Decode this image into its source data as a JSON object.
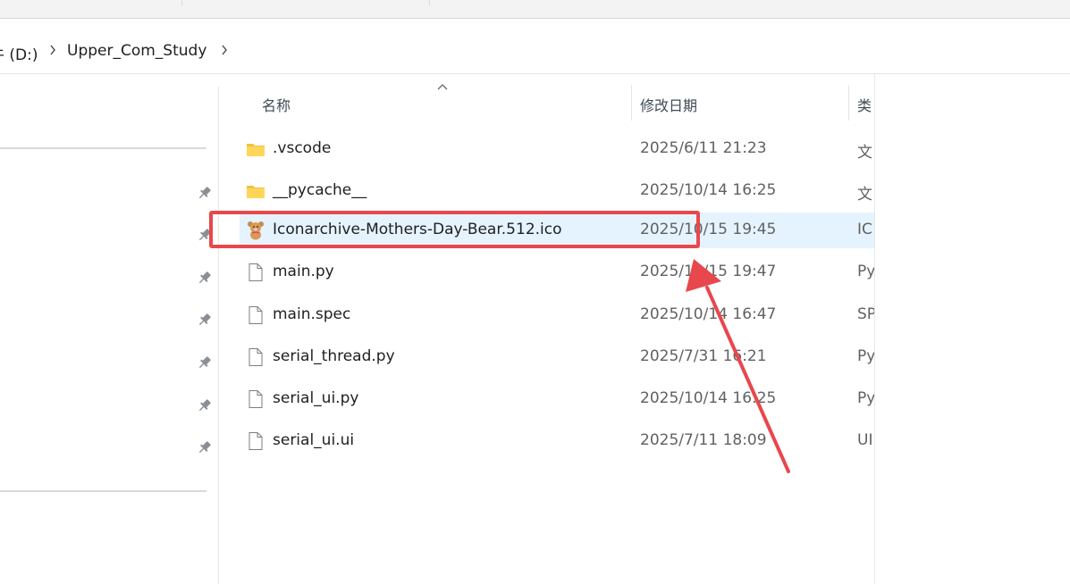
{
  "breadcrumb": {
    "drive_label": "牛 (D:)",
    "folder_label": "Upper_Com_Study"
  },
  "columns": {
    "name": "名称",
    "date": "修改日期",
    "type": "类"
  },
  "files": [
    {
      "name": ".vscode",
      "date": "2025/6/11 21:23",
      "type": "文",
      "icon": "folder-icon"
    },
    {
      "name": "__pycache__",
      "date": "2025/10/14 16:25",
      "type": "文",
      "icon": "folder-icon"
    },
    {
      "name": "Iconarchive-Mothers-Day-Bear.512.ico",
      "date": "2025/10/15 19:45",
      "type": "IC",
      "icon": "teddy-bear-icon",
      "selected": true
    },
    {
      "name": "main.py",
      "date": "2025/10/15 19:47",
      "type": "Py",
      "icon": "file-icon"
    },
    {
      "name": "main.spec",
      "date": "2025/10/14 16:47",
      "type": "SP",
      "icon": "file-icon"
    },
    {
      "name": "serial_thread.py",
      "date": "2025/7/31 16:21",
      "type": "Py",
      "icon": "file-icon"
    },
    {
      "name": "serial_ui.py",
      "date": "2025/10/14 16:25",
      "type": "Py",
      "icon": "file-icon"
    },
    {
      "name": "serial_ui.ui",
      "date": "2025/7/11 18:09",
      "type": "UI",
      "icon": "file-icon"
    }
  ],
  "annotation_color": "#e8474c",
  "selection_color": "#e5f3ff"
}
